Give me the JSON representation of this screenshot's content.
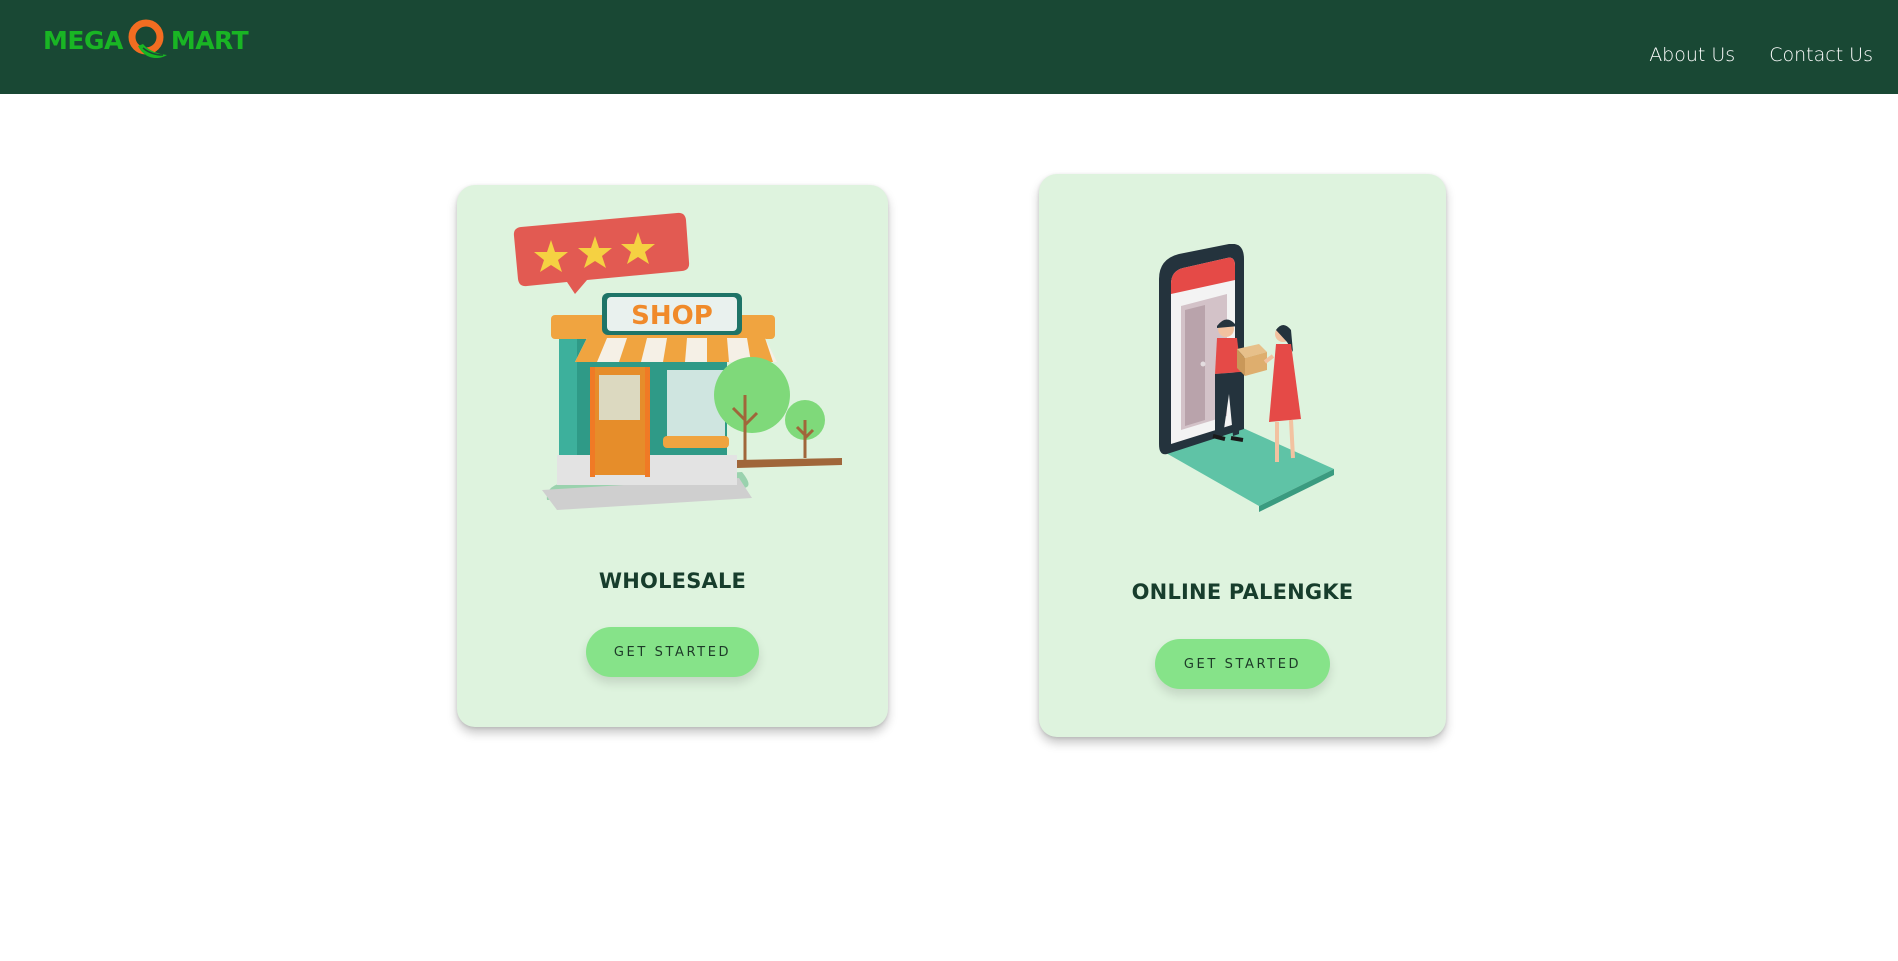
{
  "header": {
    "logo": {
      "text_left": "MEGA",
      "text_right": "MART",
      "icon": "q-leaf-logo-icon"
    },
    "nav": [
      {
        "label": "About Us"
      },
      {
        "label": "Contact Us"
      }
    ]
  },
  "cards": [
    {
      "illustration": "shop-storefront-with-rating-illustration",
      "title": "WHOLESALE",
      "button": "GET STARTED"
    },
    {
      "illustration": "phone-delivery-handoff-illustration",
      "title": "ONLINE PALENGKE",
      "button": "GET STARTED"
    }
  ],
  "colors": {
    "header_bg": "#194834",
    "logo_green": "#19b524",
    "logo_orange": "#f26d21",
    "card_bg": "#def3de",
    "button_bg": "#86e389",
    "title_text": "#173d2c"
  }
}
